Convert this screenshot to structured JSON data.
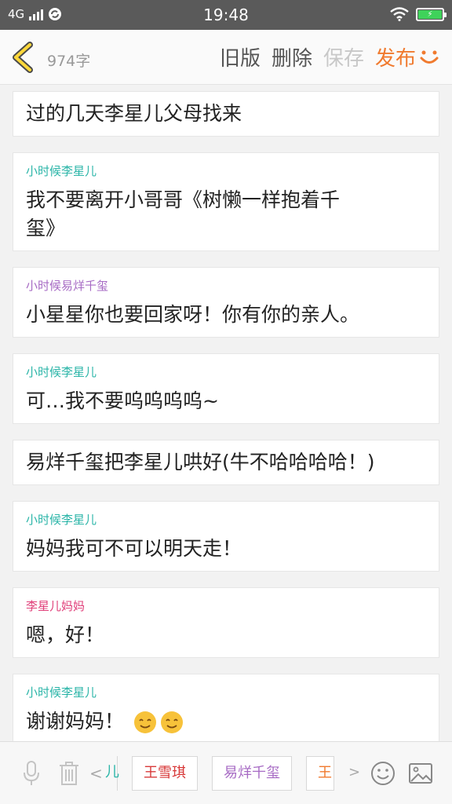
{
  "status_bar": {
    "network": "4G",
    "time": "19:48"
  },
  "header": {
    "word_count": "974字",
    "old_version": "旧版",
    "delete": "删除",
    "save": "保存",
    "publish": "发布"
  },
  "blocks": [
    {
      "speaker": "",
      "text": "过的几天李星儿父母找来"
    },
    {
      "speaker": "小时候李星儿",
      "text_line1": "我不要离开小哥哥《树懒一样抱着千",
      "text_line2": "玺》"
    },
    {
      "speaker": "小时候易烊千玺",
      "text": "小星星你也要回家呀！你有你的亲人。"
    },
    {
      "speaker": "小时候李星儿",
      "text": "可…我不要呜呜呜呜~"
    },
    {
      "speaker": "",
      "text": "易烊千玺把李星儿哄好(牛不哈哈哈哈！)"
    },
    {
      "speaker": "小时候李星儿",
      "text": "妈妈我可不可以明天走！"
    },
    {
      "speaker": "李星儿妈妈",
      "text": "嗯，好！"
    },
    {
      "speaker": "小时候李星儿",
      "text": "谢谢妈妈！"
    }
  ],
  "toolbar": {
    "characters": [
      {
        "label": "儿"
      },
      {
        "label": "王雪琪"
      },
      {
        "label": "易烊千玺"
      },
      {
        "label": "王"
      }
    ]
  },
  "colors": {
    "accent_orange": "#f07a2e",
    "speaker_teal": "#2bb5a8",
    "speaker_purple": "#a76bc4",
    "speaker_pink": "#e0407a",
    "chip_red": "#d83a3a"
  }
}
